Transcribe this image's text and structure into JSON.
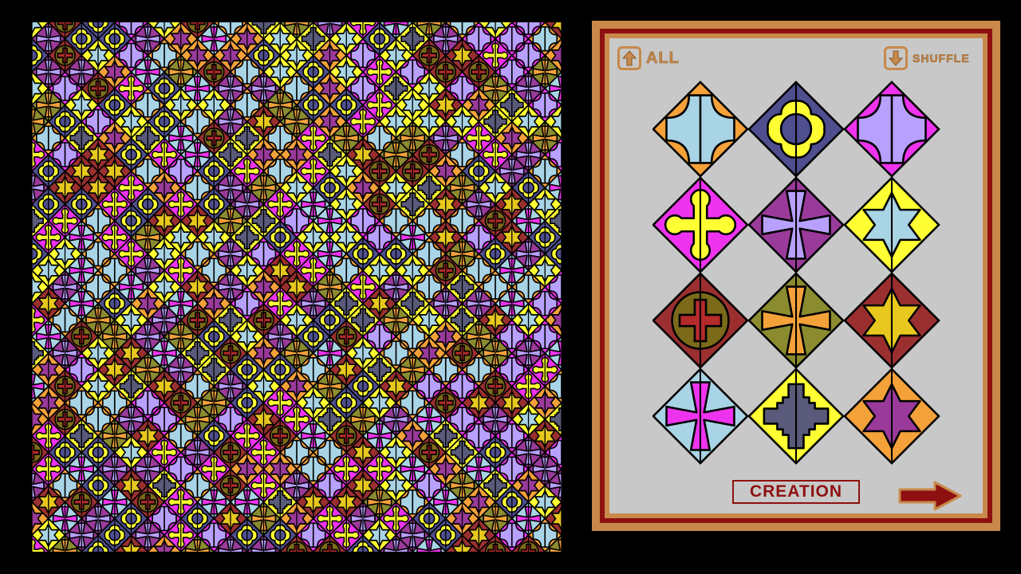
{
  "colors": {
    "orange": "#f4a13a",
    "navy": "#4f4f8f",
    "magenta": "#ee33ee",
    "purple": "#9a3a9a",
    "yellow": "#ffff33",
    "brown": "#9b2f2f",
    "olive": "#8b8b30",
    "lightblue": "#a9d4e6",
    "slate": "#5a5a7a",
    "gold": "#e8c81e",
    "lavender": "#b8a0ff",
    "red": "#b52a2a",
    "darkolive": "#7a6a1a",
    "board_bg": "#6e6e6e",
    "panel_frame": "#c8894b",
    "panel_red": "#8e1010",
    "panel_bg": "#c8c8c8"
  },
  "board": {
    "grid": 16,
    "tile_set": [
      {
        "bg": "orange",
        "fg": "lightblue",
        "shape": "roundcross"
      },
      {
        "bg": "navy",
        "fg": "yellow",
        "shape": "quatrefoil"
      },
      {
        "bg": "magenta",
        "fg": "lavender",
        "shape": "roundcross"
      },
      {
        "bg": "magenta",
        "fg": "yellow",
        "shape": "budcross"
      },
      {
        "bg": "purple",
        "fg": "lavender",
        "shape": "flarecross"
      },
      {
        "bg": "yellow",
        "fg": "lightblue",
        "shape": "star6"
      },
      {
        "bg": "brown",
        "fg": "darkolive",
        "shape": "circlecross"
      },
      {
        "bg": "olive",
        "fg": "orange",
        "shape": "flarecross"
      },
      {
        "bg": "brown",
        "fg": "gold",
        "shape": "star6"
      },
      {
        "bg": "lightblue",
        "fg": "magenta",
        "shape": "flarecross"
      },
      {
        "bg": "yellow",
        "fg": "slate",
        "shape": "steppedcross"
      },
      {
        "bg": "orange",
        "fg": "purple",
        "shape": "star6"
      }
    ]
  },
  "panel": {
    "all_label": "ALL",
    "shuffle_label": "SHUFFLE",
    "creation_label": "CREATION",
    "tiles": [
      {
        "bg": "orange",
        "fg": "lightblue",
        "shape": "roundcross"
      },
      {
        "bg": "navy",
        "fg": "yellow",
        "shape": "quatrefoil"
      },
      {
        "bg": "magenta",
        "fg": "lavender",
        "shape": "roundcross"
      },
      {
        "bg": "magenta",
        "fg": "yellow",
        "shape": "budcross"
      },
      {
        "bg": "purple",
        "fg": "lavender",
        "shape": "flarecross"
      },
      {
        "bg": "yellow",
        "fg": "lightblue",
        "shape": "star6"
      },
      {
        "bg": "brown",
        "fg": "darkolive",
        "shape": "circlecross"
      },
      {
        "bg": "olive",
        "fg": "orange",
        "shape": "flarecross"
      },
      {
        "bg": "brown",
        "fg": "gold",
        "shape": "star6"
      },
      {
        "bg": "lightblue",
        "fg": "magenta",
        "shape": "flarecross"
      },
      {
        "bg": "yellow",
        "fg": "slate",
        "shape": "steppedcross"
      },
      {
        "bg": "orange",
        "fg": "purple",
        "shape": "star6"
      }
    ]
  },
  "icons": {
    "all": "arrow-up-icon",
    "shuffle": "arrow-down-icon",
    "next": "arrow-right-icon"
  }
}
